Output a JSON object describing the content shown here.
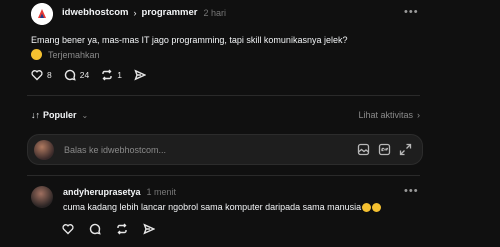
{
  "post": {
    "author": "idwebhostcom",
    "community": "programmer",
    "time": "2 hari",
    "text": "Emang bener ya, mas-mas IT jago programming, tapi skill komunikasnya jelek?",
    "translate_label": "Terjemahkan",
    "likes": "8",
    "comments": "24",
    "reposts": "1"
  },
  "thread": {
    "sort_label": "Populer",
    "activity_label": "Lihat aktivitas"
  },
  "reply": {
    "placeholder": "Balas ke idwebhostcom..."
  },
  "comment": {
    "author": "andyheruprasetya",
    "time": "1 menit",
    "text": "cuma kadang lebih lancar ngobrol sama komputer daripada sama manusia"
  },
  "colors": {
    "background": "#101010",
    "text": "#f3f5f7",
    "muted": "#8a8a8a",
    "reply_box": "#1e1e1e"
  }
}
